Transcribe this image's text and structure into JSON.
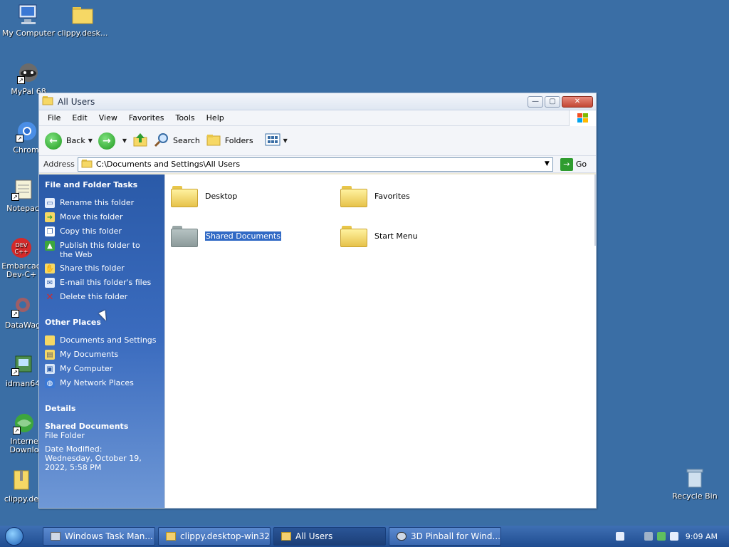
{
  "desktop": {
    "icons": [
      {
        "label": "My Computer",
        "icon": "computer-icon"
      },
      {
        "label": "clippy.desk...",
        "icon": "folder-icon"
      },
      {
        "label": "MyPal 68",
        "icon": "raccoon-icon"
      },
      {
        "label": "Chromi",
        "icon": "chromium-icon"
      },
      {
        "label": "Notepac",
        "icon": "notepad-icon"
      },
      {
        "label": "Embarcad Dev-C+",
        "icon": "devcpp-icon"
      },
      {
        "label": "DataWag",
        "icon": "datawag-icon"
      },
      {
        "label": "idman64",
        "icon": "idman-icon"
      },
      {
        "label": "Interne Downlo",
        "icon": "internet-icon"
      },
      {
        "label": "clippy.de",
        "icon": "zip-icon"
      }
    ],
    "recycle_bin_label": "Recycle Bin"
  },
  "window": {
    "title": "All Users",
    "menu": [
      "File",
      "Edit",
      "View",
      "Favorites",
      "Tools",
      "Help"
    ],
    "toolbar": {
      "back": "Back",
      "search": "Search",
      "folders": "Folders"
    },
    "address": {
      "label": "Address",
      "path": "C:\\Documents and Settings\\All Users",
      "go": "Go"
    },
    "taskpane": {
      "file_tasks_header": "File and Folder Tasks",
      "file_tasks": [
        {
          "label": "Rename this folder",
          "icon": "rename-icon"
        },
        {
          "label": "Move this folder",
          "icon": "move-icon"
        },
        {
          "label": "Copy this folder",
          "icon": "copy-icon"
        },
        {
          "label": "Publish this folder to the Web",
          "icon": "publish-icon"
        },
        {
          "label": "Share this folder",
          "icon": "share-icon"
        },
        {
          "label": "E-mail this folder's files",
          "icon": "email-icon"
        },
        {
          "label": "Delete this folder",
          "icon": "delete-icon"
        }
      ],
      "other_places_header": "Other Places",
      "other_places": [
        {
          "label": "Documents and Settings",
          "icon": "folder-icon"
        },
        {
          "label": "My Documents",
          "icon": "my-documents-icon"
        },
        {
          "label": "My Computer",
          "icon": "computer-icon"
        },
        {
          "label": "My Network Places",
          "icon": "network-icon"
        }
      ],
      "details_header": "Details",
      "details": {
        "name": "Shared Documents",
        "type": "File Folder",
        "modified": "Date Modified: Wednesday, October 19, 2022, 5:58 PM"
      }
    },
    "files": [
      {
        "label": "Desktop"
      },
      {
        "label": "Favorites"
      },
      {
        "label": "Shared Documents"
      },
      {
        "label": "Start Menu"
      }
    ]
  },
  "taskbar": {
    "buttons": [
      {
        "label": "Windows Task Man..."
      },
      {
        "label": "clippy.desktop-win32"
      },
      {
        "label": "All Users"
      },
      {
        "label": "3D Pinball for Wind..."
      }
    ],
    "clock": "9:09 AM"
  }
}
